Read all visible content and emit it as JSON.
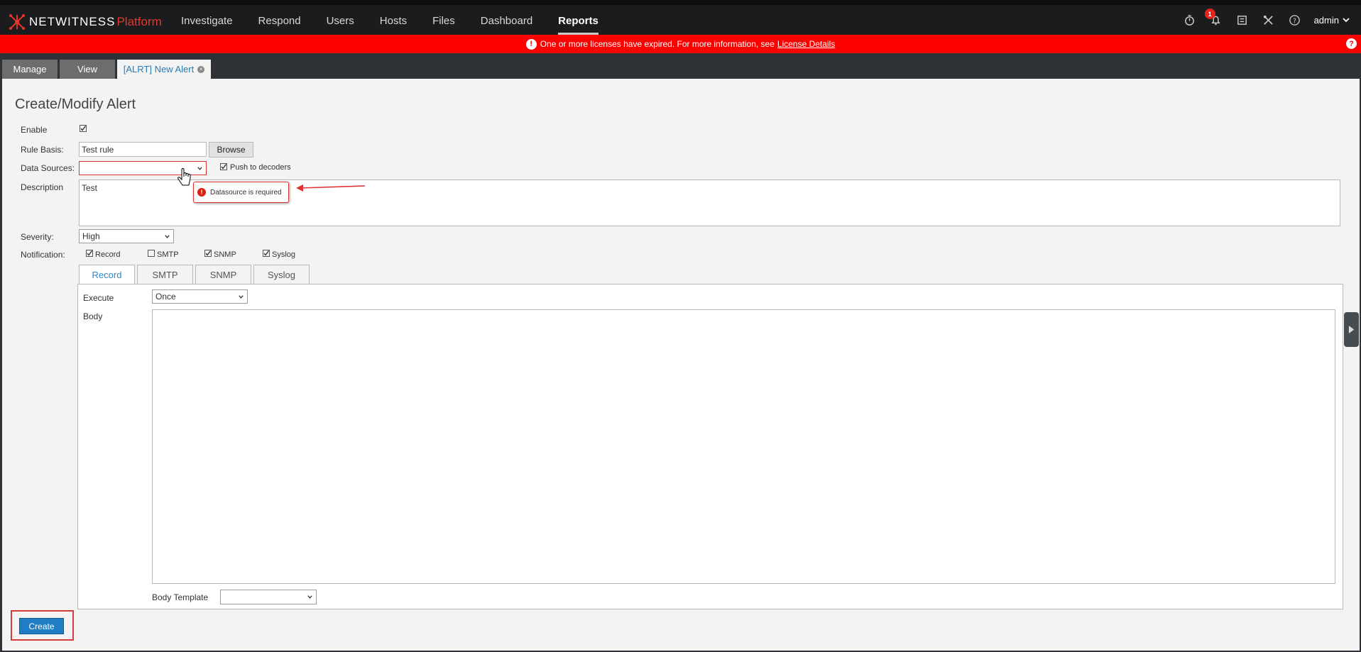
{
  "app": {
    "brand": "NETWITNESS",
    "brand_suffix": "Platform",
    "nav": [
      "Investigate",
      "Respond",
      "Users",
      "Hosts",
      "Files",
      "Dashboard",
      "Reports"
    ],
    "active_nav": "Reports",
    "notification_count": "1",
    "user": "admin"
  },
  "banner": {
    "message": "One or more licenses have expired. For more information, see",
    "link": "License Details",
    "help": "?"
  },
  "tabs": [
    "Manage",
    "View",
    "[ALRT] New Alert"
  ],
  "form": {
    "title": "Create/Modify Alert",
    "enable_label": "Enable",
    "enable_checked": true,
    "rule_basis_label": "Rule Basis:",
    "rule_basis_value": "Test rule",
    "browse_label": "Browse",
    "data_sources_label": "Data Sources:",
    "data_sources_value": "",
    "push_label": "Push to decoders",
    "push_checked": true,
    "description_label": "Description",
    "description_value": "Test",
    "validation_error": "Datasource is required",
    "severity_label": "Severity:",
    "severity_value": "High",
    "notification_label": "Notification:",
    "notification_options": [
      {
        "label": "Record",
        "checked": true
      },
      {
        "label": "SMTP",
        "checked": false
      },
      {
        "label": "SNMP",
        "checked": true
      },
      {
        "label": "Syslog",
        "checked": true
      }
    ],
    "notification_tabs": [
      "Record",
      "SMTP",
      "SNMP",
      "Syslog"
    ],
    "active_notification_tab": "Record",
    "execute_label": "Execute",
    "execute_value": "Once",
    "body_label": "Body",
    "body_value": "",
    "body_template_label": "Body Template",
    "body_template_value": "",
    "create_label": "Create"
  },
  "colors": {
    "banner": "#fd0000",
    "accent": "#1f7ec3",
    "brand_red": "#e3352b",
    "error": "#d33"
  }
}
